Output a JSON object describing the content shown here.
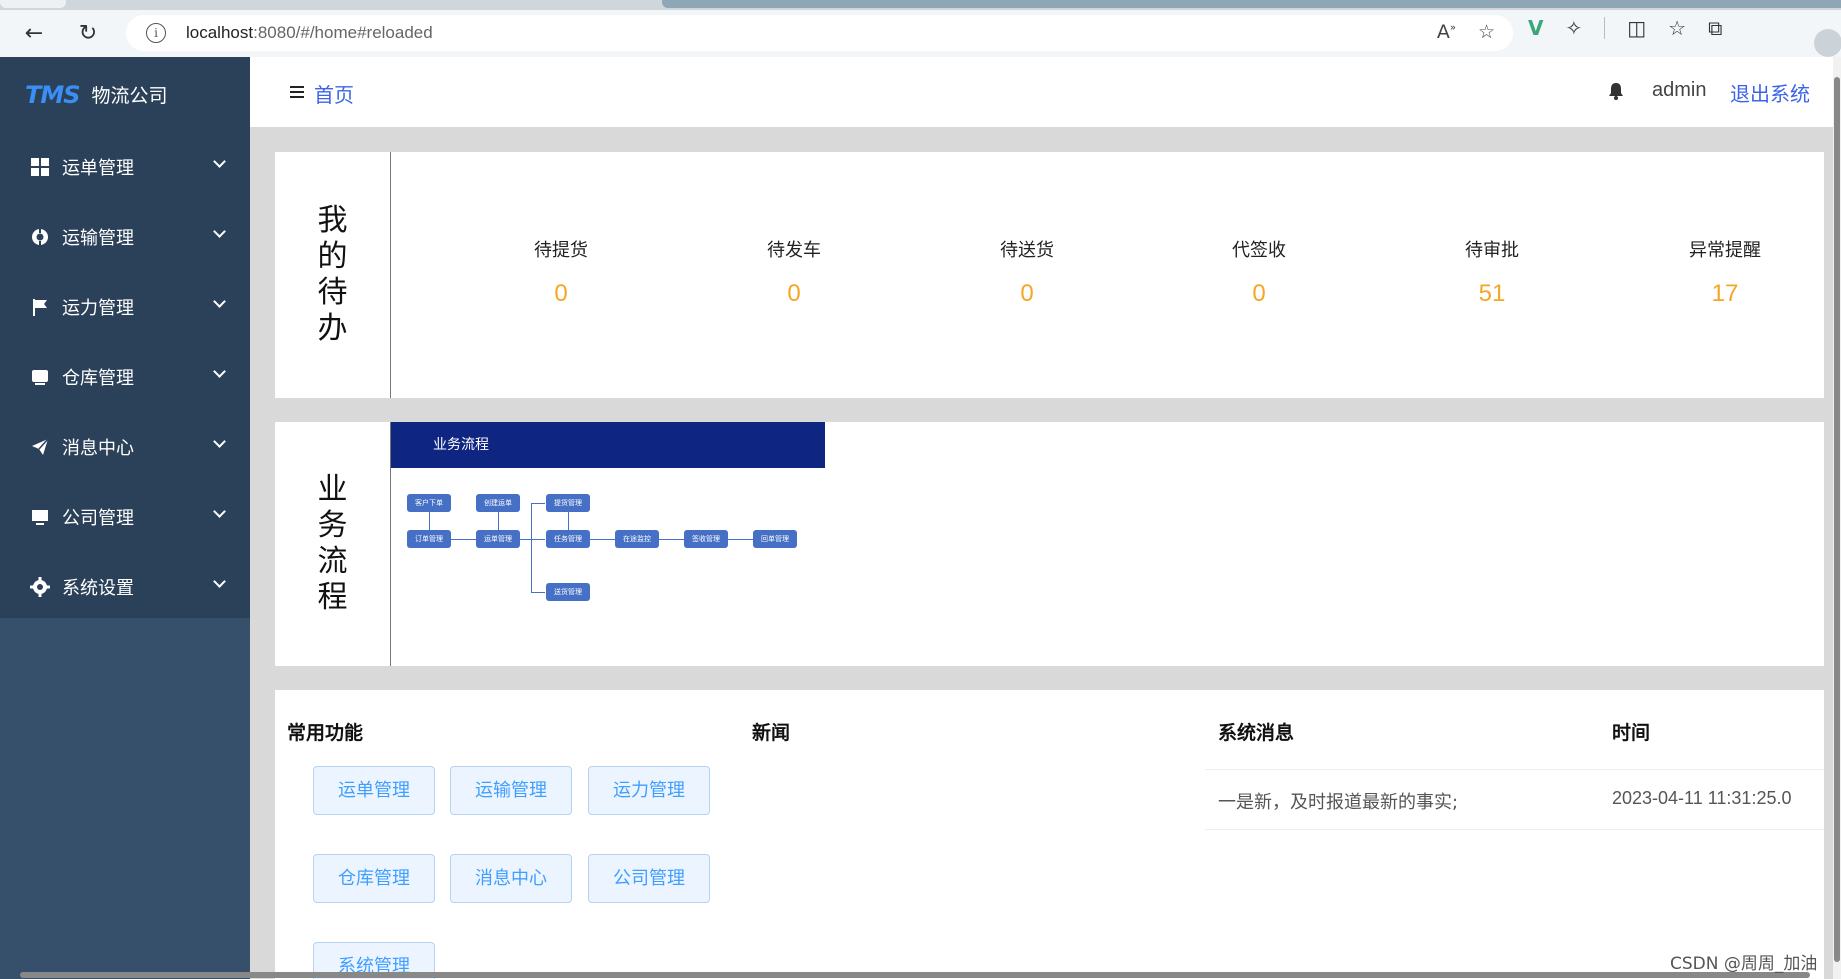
{
  "browser": {
    "url_host": "localhost",
    "url_rest": ":8080/#/home#reloaded"
  },
  "sidebar": {
    "logo_text": "TMS",
    "company": "物流公司",
    "items": [
      {
        "label": "运单管理",
        "icon": "grid-icon"
      },
      {
        "label": "运输管理",
        "icon": "lifebuoy-icon"
      },
      {
        "label": "运力管理",
        "icon": "flag-icon"
      },
      {
        "label": "仓库管理",
        "icon": "inbox-icon"
      },
      {
        "label": "消息中心",
        "icon": "send-icon"
      },
      {
        "label": "公司管理",
        "icon": "monitor-icon"
      },
      {
        "label": "系统设置",
        "icon": "gear-icon"
      }
    ]
  },
  "header": {
    "breadcrumb": "首页",
    "username": "admin",
    "logout": "退出系统"
  },
  "todo": {
    "title": "我的待办",
    "items": [
      {
        "label": "待提货",
        "value": "0"
      },
      {
        "label": "待发车",
        "value": "0"
      },
      {
        "label": "待送货",
        "value": "0"
      },
      {
        "label": "代签收",
        "value": "0"
      },
      {
        "label": "待审批",
        "value": "51"
      },
      {
        "label": "异常提醒",
        "value": "17"
      }
    ],
    "value_color": "#f5a623"
  },
  "flow": {
    "title": "业务流程",
    "banner": "业务流程",
    "nodes": [
      "客户下单",
      "创建运单",
      "提货管理",
      "订单管理",
      "运单管理",
      "任务管理",
      "在途监控",
      "签收管理",
      "回单管理",
      "送货管理"
    ]
  },
  "bottom": {
    "quick_title": "常用功能",
    "news_title": "新闻",
    "msg_title": "系统消息",
    "time_title": "时间",
    "quick_buttons": [
      "运单管理",
      "运输管理",
      "运力管理",
      "仓库管理",
      "消息中心",
      "公司管理",
      "系统管理"
    ],
    "messages": [
      {
        "text": "一是新，及时报道最新的事实;",
        "time": "2023-04-11 11:31:25.0"
      }
    ]
  },
  "watermark": "CSDN @周周_加油"
}
